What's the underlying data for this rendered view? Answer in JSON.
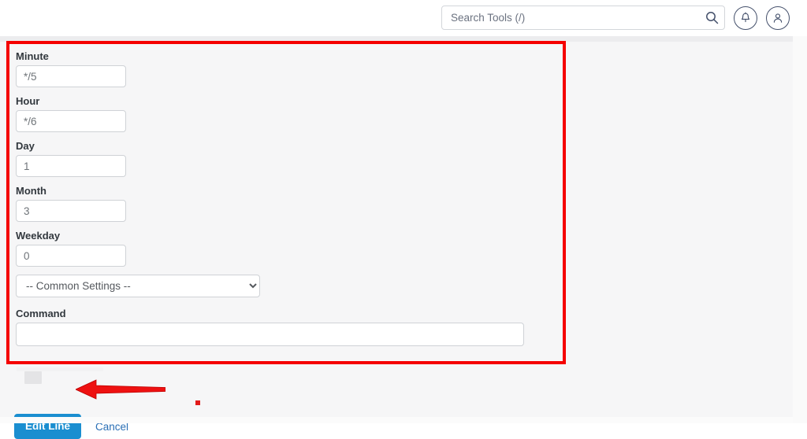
{
  "header": {
    "search": {
      "placeholder": "Search Tools (/)",
      "value": "",
      "icon": "search-icon"
    },
    "notifications_icon": "bell-icon",
    "account_icon": "user-icon"
  },
  "form": {
    "fields": [
      {
        "label": "Minute",
        "value": "*/5",
        "name": "minute"
      },
      {
        "label": "Hour",
        "value": "*/6",
        "name": "hour"
      },
      {
        "label": "Day",
        "value": "1",
        "name": "day"
      },
      {
        "label": "Month",
        "value": "3",
        "name": "month"
      },
      {
        "label": "Weekday",
        "value": "0",
        "name": "weekday"
      }
    ],
    "common_settings": {
      "selected": "-- Common Settings --",
      "options": [
        "-- Common Settings --"
      ]
    },
    "command": {
      "label": "Command",
      "value": "",
      "placeholder": ""
    }
  },
  "actions": {
    "submit_label": "Edit Line",
    "cancel_label": "Cancel"
  },
  "colors": {
    "primary_button": "#1a8ed0",
    "annotation": "#f50000",
    "link": "#2a6fb5",
    "panel_bg": "#f6f6f7"
  }
}
